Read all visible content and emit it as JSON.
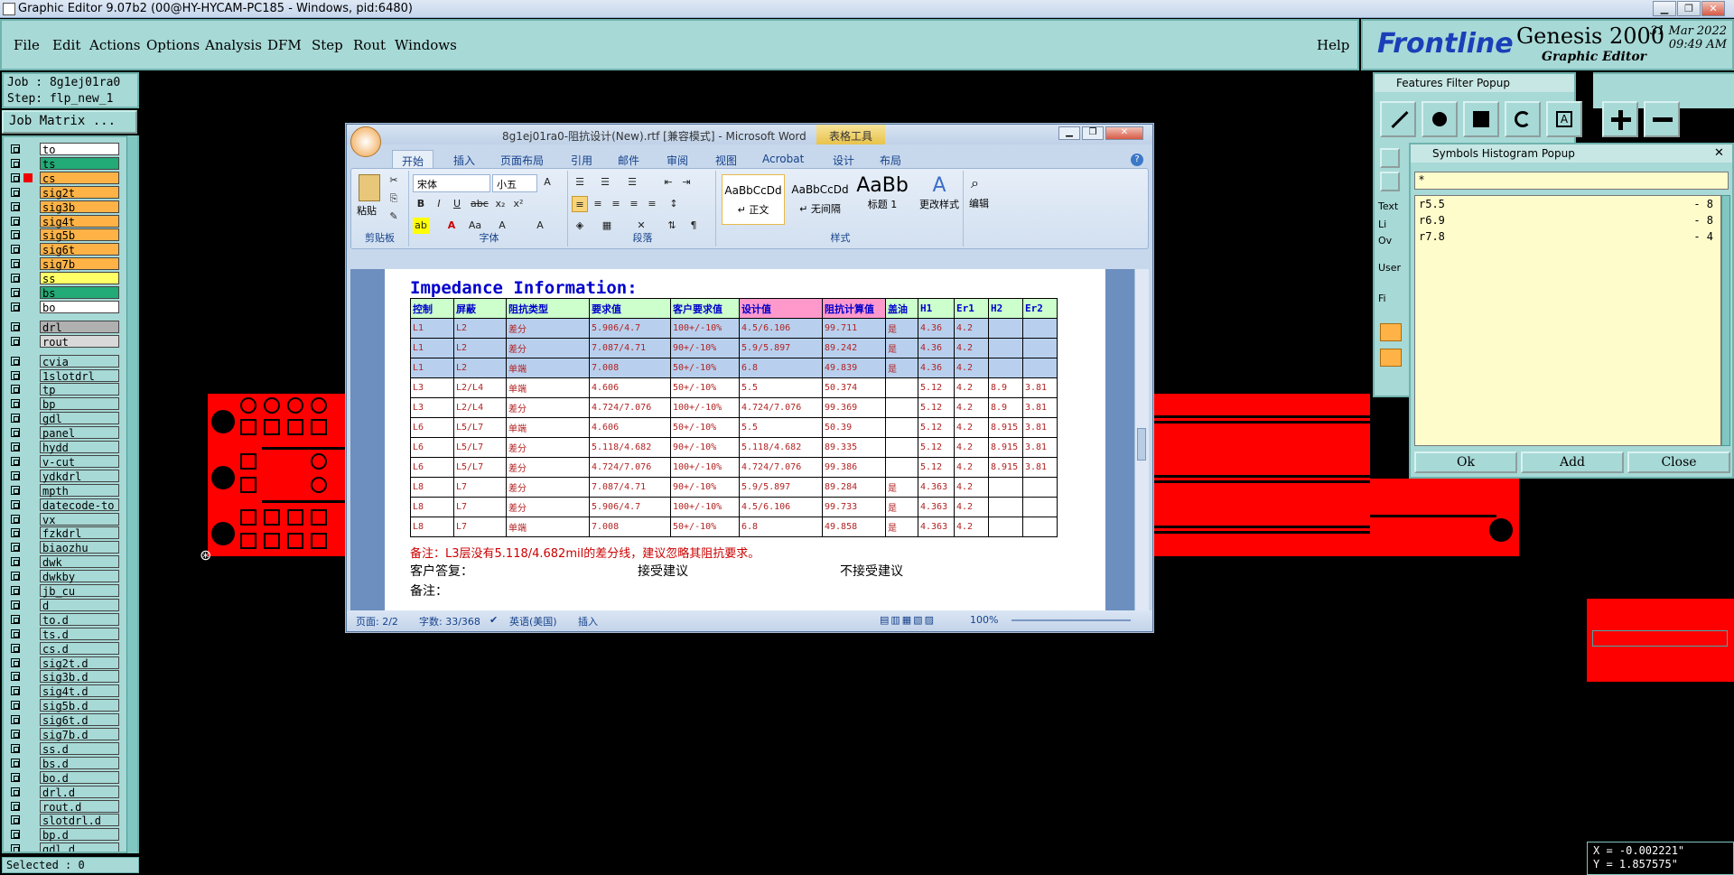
{
  "window": {
    "title": "Graphic Editor 9.07b2 (00@HY-HYCAM-PC185 - Windows, pid:6480)",
    "min_label": "▁",
    "restore_label": "❐",
    "close_label": "✕"
  },
  "menubar": {
    "items": [
      "File",
      "Edit",
      "Actions",
      "Options",
      "Analysis",
      "DFM",
      "Step",
      "Rout",
      "Windows"
    ],
    "help_label": "Help"
  },
  "brand": {
    "logo": "Frontline",
    "product": "Genesis 2000",
    "subtitle": "Graphic Editor",
    "date": "31 Mar 2022",
    "time": "09:49 AM"
  },
  "job": {
    "job_line": "Job : 8g1ej01ra0",
    "step_line": "Step: flp_new_1",
    "matrix_label": "Job Matrix ..."
  },
  "layers": [
    {
      "name": "to",
      "color": "#ffffff"
    },
    {
      "name": "ts",
      "color": "#22aa77"
    },
    {
      "name": "cs",
      "color": "#ffb347"
    },
    {
      "name": "sig2t",
      "color": "#ffb347"
    },
    {
      "name": "sig3b",
      "color": "#ffb347"
    },
    {
      "name": "sig4t",
      "color": "#ffb347"
    },
    {
      "name": "sig5b",
      "color": "#ffb347"
    },
    {
      "name": "sig6t",
      "color": "#ffb347"
    },
    {
      "name": "sig7b",
      "color": "#ffb347"
    },
    {
      "name": "ss",
      "color": "#ffff66"
    },
    {
      "name": "bs",
      "color": "#22aa77"
    },
    {
      "name": "bo",
      "color": "#ffffff"
    },
    {
      "name": "drl",
      "color": "#b0b0b0"
    },
    {
      "name": "rout",
      "color": "#d9d9d9"
    },
    {
      "name": "cvia",
      "color": "#a7d9d6"
    },
    {
      "name": "1slotdrl",
      "color": "#a7d9d6"
    },
    {
      "name": "tp",
      "color": "#a7d9d6"
    },
    {
      "name": "bp",
      "color": "#a7d9d6"
    },
    {
      "name": "gdl",
      "color": "#a7d9d6"
    },
    {
      "name": "panel",
      "color": "#a7d9d6"
    },
    {
      "name": "hydd",
      "color": "#a7d9d6"
    },
    {
      "name": "v-cut",
      "color": "#a7d9d6"
    },
    {
      "name": "ydkdrl",
      "color": "#a7d9d6"
    },
    {
      "name": "mpth",
      "color": "#a7d9d6"
    },
    {
      "name": "datecode-to",
      "color": "#a7d9d6"
    },
    {
      "name": "vx",
      "color": "#a7d9d6"
    },
    {
      "name": "fzkdrl",
      "color": "#a7d9d6"
    },
    {
      "name": "biaozhu",
      "color": "#a7d9d6"
    },
    {
      "name": "dwk",
      "color": "#a7d9d6"
    },
    {
      "name": "dwkby",
      "color": "#a7d9d6"
    },
    {
      "name": "jb_cu",
      "color": "#a7d9d6"
    },
    {
      "name": "d",
      "color": "#a7d9d6"
    },
    {
      "name": "to.d",
      "color": "#a7d9d6"
    },
    {
      "name": "ts.d",
      "color": "#a7d9d6"
    },
    {
      "name": "cs.d",
      "color": "#a7d9d6"
    },
    {
      "name": "sig2t.d",
      "color": "#a7d9d6"
    },
    {
      "name": "sig3b.d",
      "color": "#a7d9d6"
    },
    {
      "name": "sig4t.d",
      "color": "#a7d9d6"
    },
    {
      "name": "sig5b.d",
      "color": "#a7d9d6"
    },
    {
      "name": "sig6t.d",
      "color": "#a7d9d6"
    },
    {
      "name": "sig7b.d",
      "color": "#a7d9d6"
    },
    {
      "name": "ss.d",
      "color": "#a7d9d6"
    },
    {
      "name": "bs.d",
      "color": "#a7d9d6"
    },
    {
      "name": "bo.d",
      "color": "#a7d9d6"
    },
    {
      "name": "drl.d",
      "color": "#a7d9d6"
    },
    {
      "name": "rout.d",
      "color": "#a7d9d6"
    },
    {
      "name": "slotdrl.d",
      "color": "#a7d9d6"
    },
    {
      "name": "bp.d",
      "color": "#a7d9d6"
    },
    {
      "name": "gdl.d",
      "color": "#a7d9d6"
    }
  ],
  "selected": "Selected : 0",
  "word": {
    "title": "8g1ej01ra0-阻抗设计(New).rtf [兼容模式] - Microsoft Word",
    "context_tab": "表格工具",
    "tabs": [
      "开始",
      "插入",
      "页面布局",
      "引用",
      "邮件",
      "审阅",
      "视图",
      "Acrobat",
      "设计",
      "布局"
    ],
    "font_name": "宋体",
    "font_size": "小五",
    "groups": {
      "clipboard": "剪贴板",
      "font": "字体",
      "paragraph": "段落",
      "styles": "样式",
      "edit": "编辑"
    },
    "paste": "粘贴",
    "styles": [
      {
        "preview": "AaBbCcDd",
        "label": "↵ 正文"
      },
      {
        "preview": "AaBbCcDd",
        "label": "↵ 无间隔"
      },
      {
        "preview": "AaBb",
        "label": "标题 1"
      }
    ],
    "change_styles": "更改样式",
    "edit_label": "编辑",
    "doc_heading": "Impedance Information:",
    "table_headers": [
      "控制",
      "屏蔽",
      "阻抗类型",
      "要求值",
      "客户要求值",
      "设计值",
      "阻抗计算值",
      "盖油",
      "H1",
      "Er1",
      "H2",
      "Er2"
    ],
    "table_rows": [
      [
        "L1",
        "L2",
        "差分",
        "5.906/4.7",
        "100+/-10%",
        "4.5/6.106",
        "99.711",
        "是",
        "4.36",
        "4.2",
        "",
        ""
      ],
      [
        "L1",
        "L2",
        "差分",
        "7.087/4.71",
        "90+/-10%",
        "5.9/5.897",
        "89.242",
        "是",
        "4.36",
        "4.2",
        "",
        ""
      ],
      [
        "L1",
        "L2",
        "单端",
        "7.008",
        "50+/-10%",
        "6.8",
        "49.839",
        "是",
        "4.36",
        "4.2",
        "",
        ""
      ],
      [
        "L3",
        "L2/L4",
        "单端",
        "4.606",
        "50+/-10%",
        "5.5",
        "50.374",
        "",
        "5.12",
        "4.2",
        "8.9",
        "3.81"
      ],
      [
        "L3",
        "L2/L4",
        "差分",
        "4.724/7.076",
        "100+/-10%",
        "4.724/7.076",
        "99.369",
        "",
        "5.12",
        "4.2",
        "8.9",
        "3.81"
      ],
      [
        "L6",
        "L5/L7",
        "单端",
        "4.606",
        "50+/-10%",
        "5.5",
        "50.39",
        "",
        "5.12",
        "4.2",
        "8.915",
        "3.81"
      ],
      [
        "L6",
        "L5/L7",
        "差分",
        "5.118/4.682",
        "90+/-10%",
        "5.118/4.682",
        "89.335",
        "",
        "5.12",
        "4.2",
        "8.915",
        "3.81"
      ],
      [
        "L6",
        "L5/L7",
        "差分",
        "4.724/7.076",
        "100+/-10%",
        "4.724/7.076",
        "99.386",
        "",
        "5.12",
        "4.2",
        "8.915",
        "3.81"
      ],
      [
        "L8",
        "L7",
        "差分",
        "7.087/4.71",
        "90+/-10%",
        "5.9/5.897",
        "89.284",
        "是",
        "4.363",
        "4.2",
        "",
        ""
      ],
      [
        "L8",
        "L7",
        "差分",
        "5.906/4.7",
        "100+/-10%",
        "4.5/6.106",
        "99.733",
        "是",
        "4.363",
        "4.2",
        "",
        ""
      ],
      [
        "L8",
        "L7",
        "单端",
        "7.008",
        "50+/-10%",
        "6.8",
        "49.858",
        "是",
        "4.363",
        "4.2",
        "",
        ""
      ]
    ],
    "note_red": "备注：L3层没有5.118/4.682mil的差分线，建议忽略其阻抗要求。",
    "reply_label": "客户答复：",
    "accept": "接受建议",
    "reject": "不接受建议",
    "note2": "备注：",
    "status_page": "页面: 2/2",
    "status_words": "字数: 33/368",
    "status_lang": "英语(美国)",
    "status_mode": "插入",
    "zoom": "100%"
  },
  "features_filter": {
    "title": "Features Filter Popup",
    "labels": [
      "Text",
      "Li",
      "Ov",
      "User",
      "Fi"
    ]
  },
  "symbols_histogram": {
    "title": "Symbols Histogram Popup",
    "filter": "*",
    "rows": [
      {
        "symbol": "r5.5",
        "count": "- 8"
      },
      {
        "symbol": "r6.9",
        "count": "- 8"
      },
      {
        "symbol": "r7.8",
        "count": "- 4"
      }
    ],
    "ok": "Ok",
    "add": "Add",
    "close": "Close"
  },
  "coords": {
    "x": "X = -0.002221\"",
    "y": "Y = 1.857575\""
  }
}
